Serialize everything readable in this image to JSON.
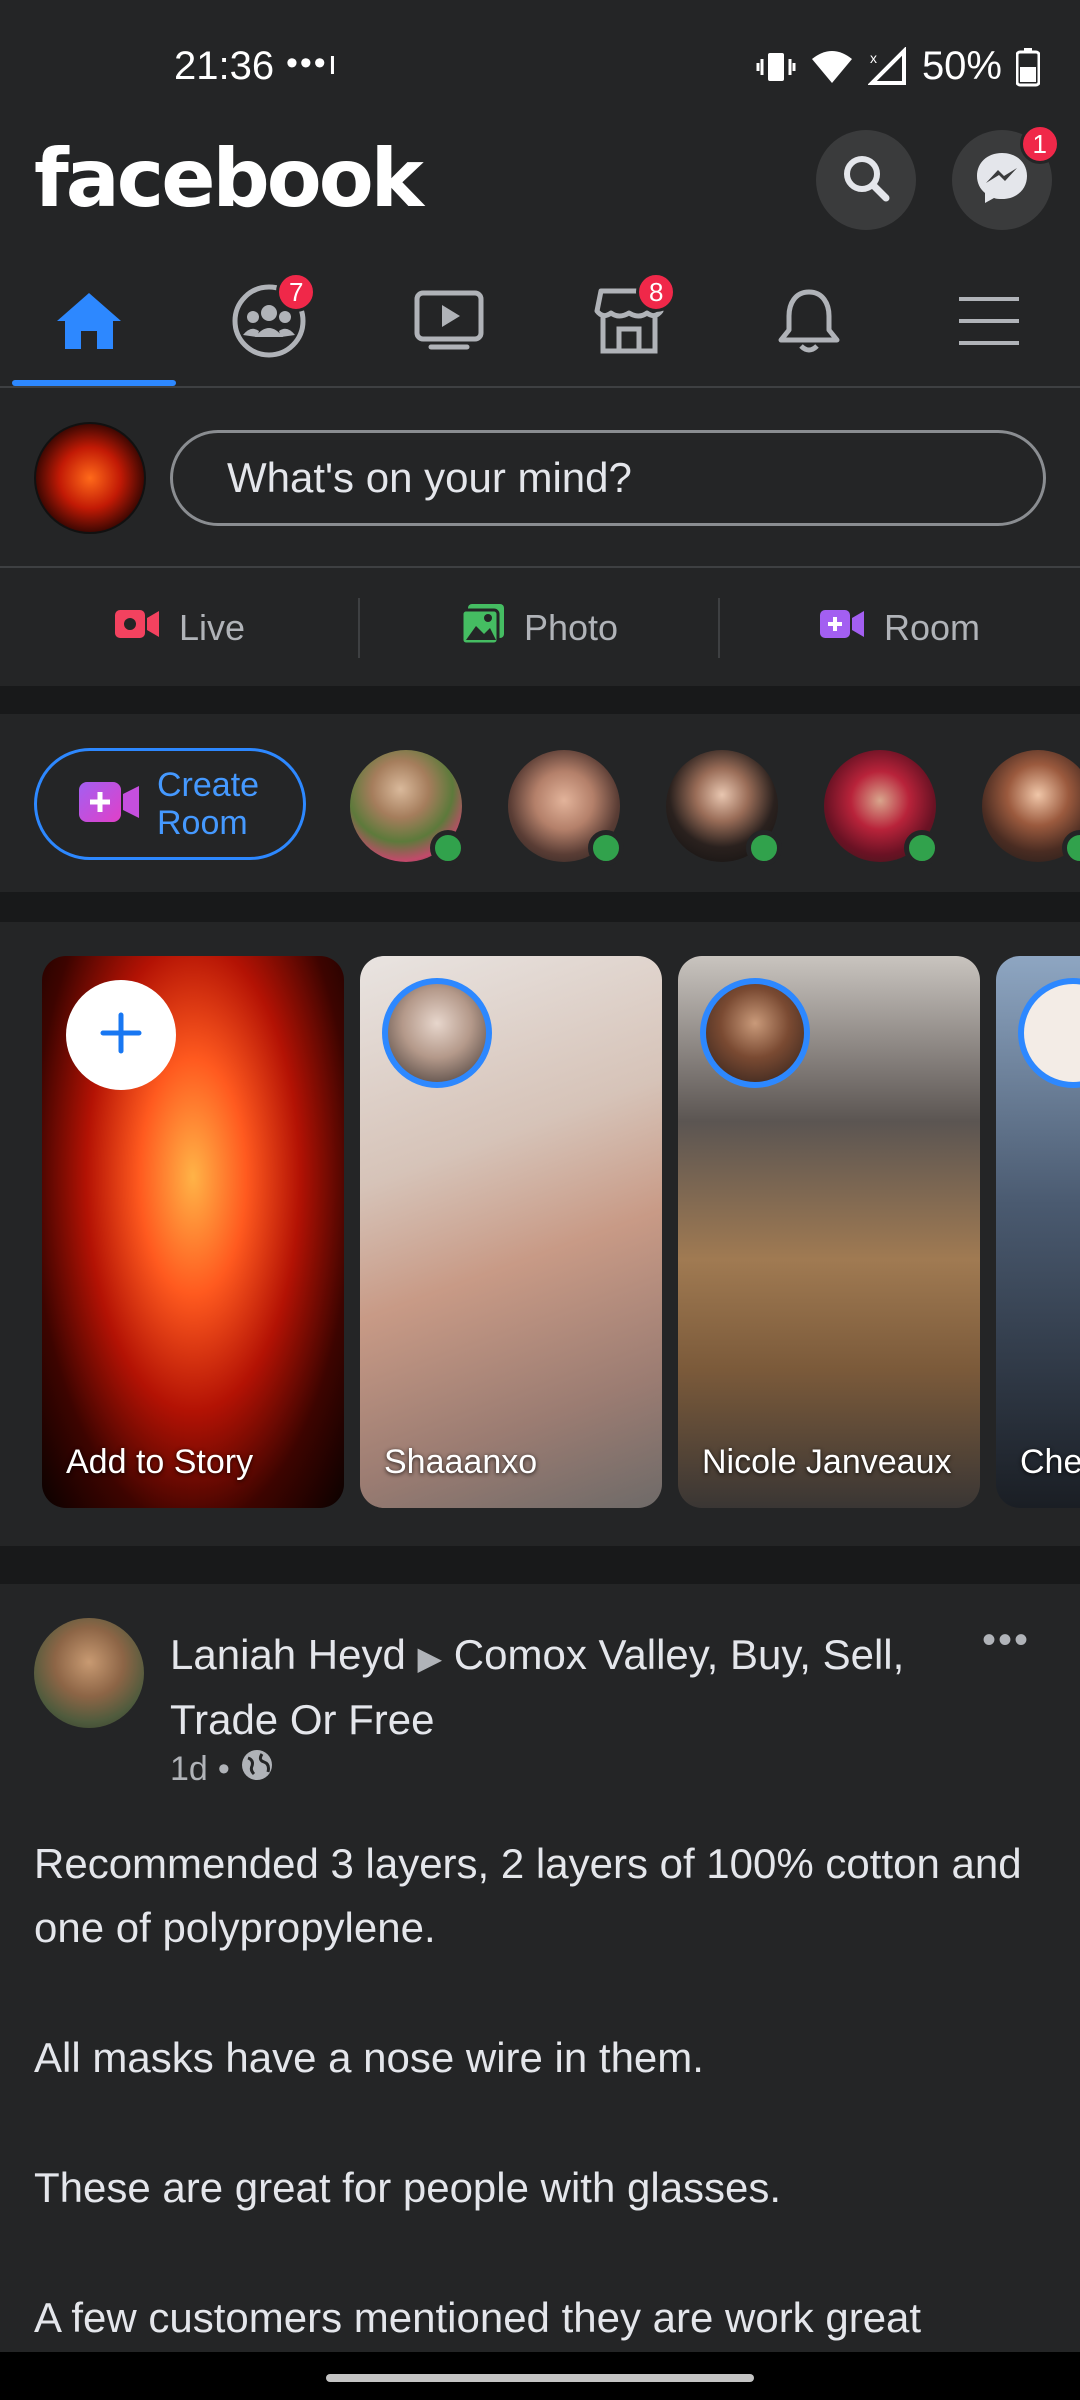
{
  "status": {
    "time": "21:36",
    "dots": "•••ı",
    "battery": "50%"
  },
  "header": {
    "logo": "facebook",
    "messenger_badge": "1"
  },
  "tabs": [
    {
      "name": "home",
      "active": true,
      "badge": ""
    },
    {
      "name": "groups",
      "active": false,
      "badge": "7"
    },
    {
      "name": "watch",
      "active": false,
      "badge": ""
    },
    {
      "name": "marketplace",
      "active": false,
      "badge": "8"
    },
    {
      "name": "notifications",
      "active": false,
      "badge": ""
    },
    {
      "name": "menu",
      "active": false,
      "badge": ""
    }
  ],
  "composer": {
    "placeholder": "What's on your mind?"
  },
  "actions": {
    "live": "Live",
    "photo": "Photo",
    "room": "Room"
  },
  "rooms": {
    "create_label": "Create Room"
  },
  "stories": {
    "add": "Add to Story",
    "items": [
      {
        "name": "Shaaanxo"
      },
      {
        "name": "Nicole Janveaux"
      },
      {
        "name": "Che"
      }
    ]
  },
  "post": {
    "author": "Laniah Heyd",
    "group": "Comox Valley, Buy, Sell, Trade Or Free",
    "time": "1d",
    "paragraphs": [
      "Recommended 3 layers, 2 layers of 100% cotton and one of polypropylene.",
      "All masks have a nose wire in them.",
      "These are great for people with glasses.",
      "A few customers mentioned they are work great"
    ]
  },
  "colors": {
    "background": "#242526",
    "accent": "#2d88ff",
    "badge": "#f02849",
    "online": "#31a24c"
  }
}
